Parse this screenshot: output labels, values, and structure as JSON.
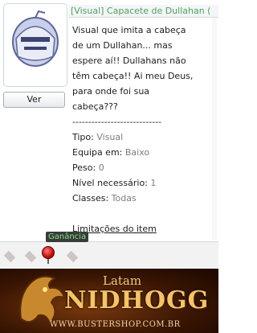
{
  "item": {
    "title": "[Visual] Capacete de Dullahan (",
    "view_button": "Ver",
    "description": "Visual que imita a cabeça\nde um Dullahan... mas\nespere aí!! Dullahans não\ntêm cabeça!! Ai meu Deus,\npara onde foi sua\ncabeça???",
    "separator": "----------------------------",
    "props": [
      {
        "label": "Tipo: ",
        "value": "Visual"
      },
      {
        "label": "Equipa em: ",
        "value": "Baixo"
      },
      {
        "label": "Peso: ",
        "value": "0"
      },
      {
        "label": "Nível necessário: ",
        "value": "1"
      },
      {
        "label": "Classes: ",
        "value": "Todas"
      }
    ],
    "limits_link": "Limitações do item"
  },
  "tooltip": "Ganância",
  "banner": {
    "latam": "Latam",
    "name": "NIDHOGG",
    "site": "WWW.BUSTERSHOP.COM.BR"
  },
  "colors": {
    "title_green": "#4fa15c",
    "value_gray": "#7c7c7c"
  }
}
